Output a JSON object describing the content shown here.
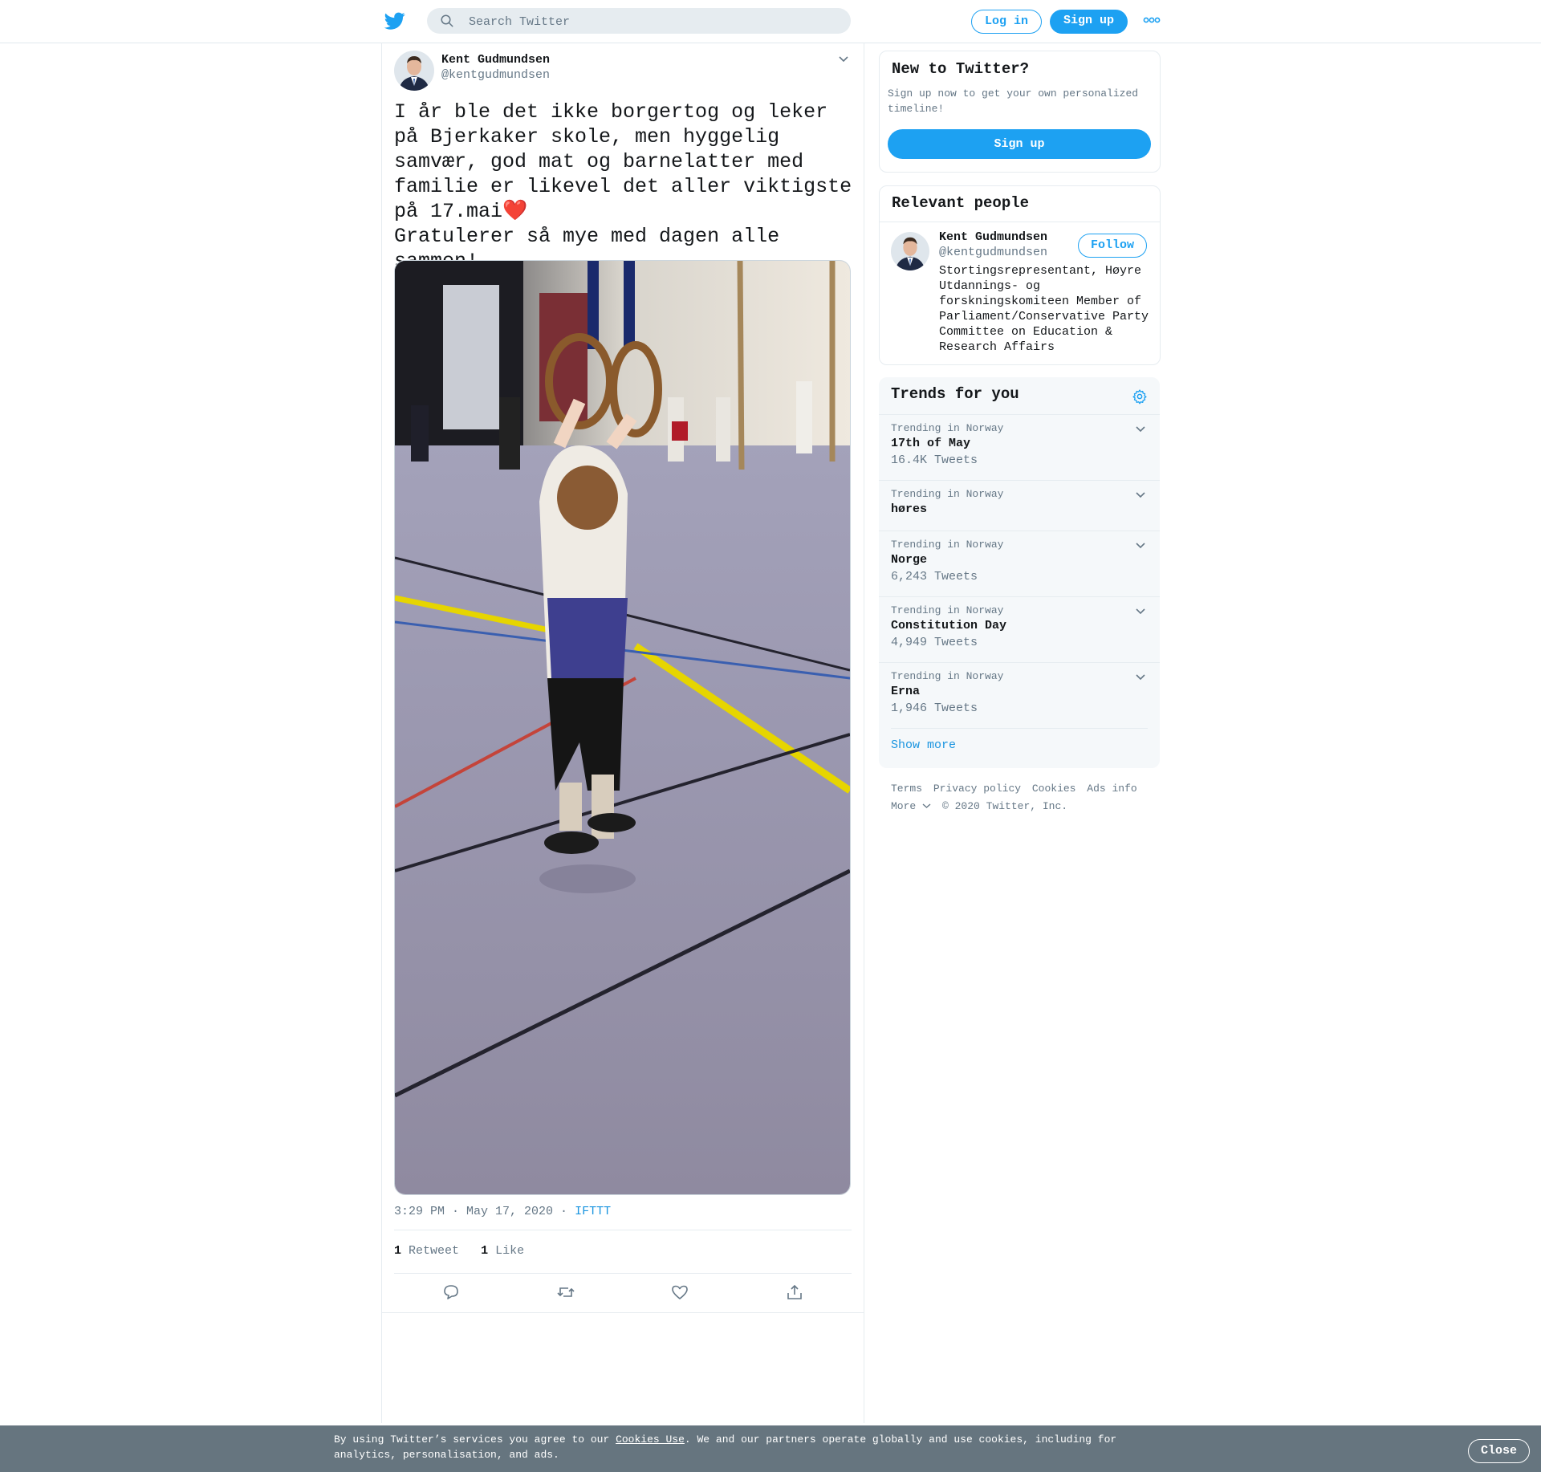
{
  "header": {
    "search_placeholder": "Search Twitter",
    "login_label": "Log in",
    "signup_label": "Sign up"
  },
  "tweet": {
    "author_name": "Kent Gudmundsen",
    "author_handle": "@kentgudmundsen",
    "text_line1": "I år ble det ikke borgertog og leker på Bjerkaker skole, men hyggelig samvær, god mat og barnelatter med familie er likevel det aller viktigste på 17.mai",
    "text_line2": "Gratulerer så mye med dagen alle sammen!",
    "emoji_heart": "❤️",
    "emoji_party": "🥳",
    "emoji_flag": "🇳🇴",
    "time": "3:29 PM · May 17, 2020",
    "separator": " · ",
    "source": "IFTTT",
    "retweet_count": "1",
    "retweet_label": "Retweet",
    "like_count": "1",
    "like_label": "Like"
  },
  "sidebar": {
    "new_title": "New to Twitter?",
    "new_desc": "Sign up now to get your own personalized timeline!",
    "new_signup": "Sign up",
    "relevant_title": "Relevant people",
    "person_name": "Kent Gudmundsen",
    "person_handle": "@kentgudmundsen",
    "follow_label": "Follow",
    "person_bio": "Stortingsrepresentant, Høyre Utdannings- og forskningskomiteen Member of Parliament/Conservative Party Committee on Education & Research Affairs",
    "trends_title": "Trends for you",
    "trends": [
      {
        "context": "Trending in Norway",
        "name": "17th of May",
        "count": "16.4K Tweets"
      },
      {
        "context": "Trending in Norway",
        "name": "høres",
        "count": ""
      },
      {
        "context": "Trending in Norway",
        "name": "Norge",
        "count": "6,243 Tweets"
      },
      {
        "context": "Trending in Norway",
        "name": "Constitution Day",
        "count": "4,949 Tweets"
      },
      {
        "context": "Trending in Norway",
        "name": "Erna",
        "count": "1,946 Tweets"
      }
    ],
    "show_more": "Show more"
  },
  "footer": {
    "links": [
      "Terms",
      "Privacy policy",
      "Cookies",
      "Ads info"
    ],
    "more": "More",
    "copyright": "© 2020 Twitter, Inc."
  },
  "cookie": {
    "text_before": "By using Twitter’s services you agree to our ",
    "link": "Cookies Use",
    "text_after": ". We and our partners operate globally and use cookies, including for analytics, personalisation, and ads.",
    "close": "Close"
  },
  "colors": {
    "accent": "#1da1f2",
    "link": "#1b95e0",
    "secondary_text": "#657786",
    "heart": "#e0245e",
    "cookie_bg": "#66757f"
  }
}
